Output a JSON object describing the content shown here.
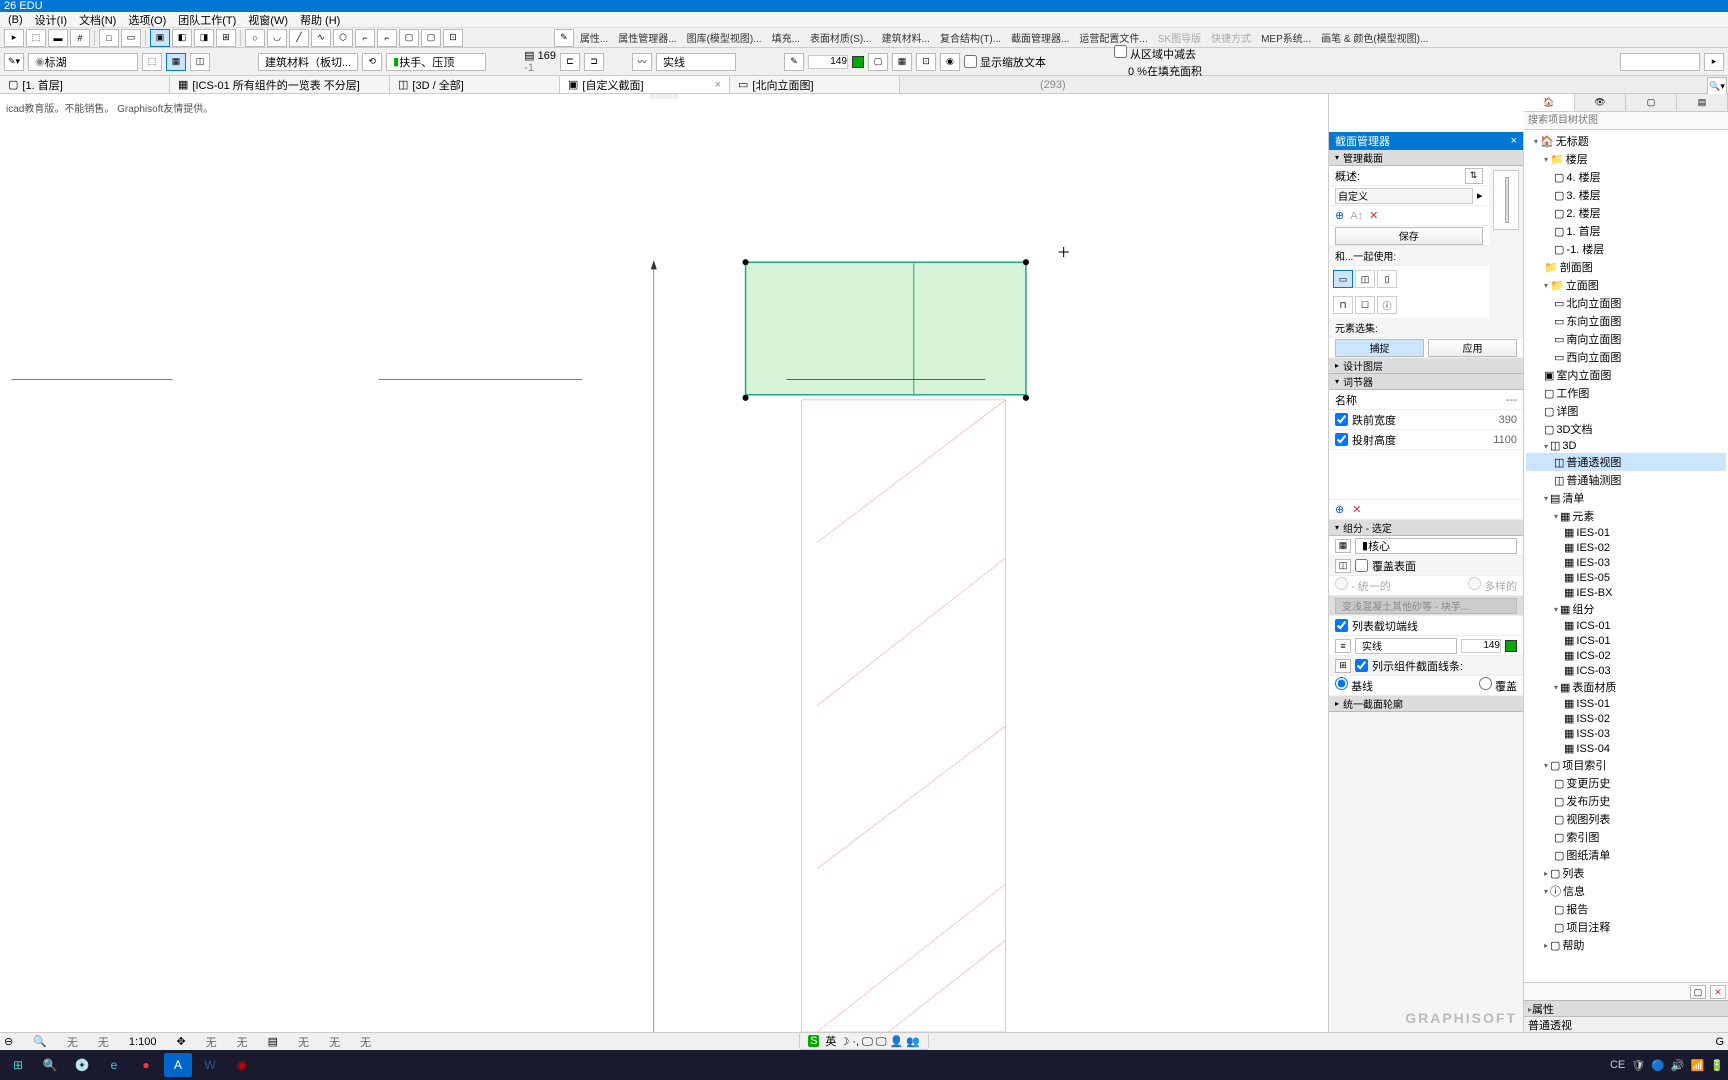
{
  "title": "26 EDU",
  "menus": [
    "(B)",
    "设计(I)",
    "文档(N)",
    "选项(O)",
    "团队工作(T)",
    "视窗(W)",
    "帮助 (H)"
  ],
  "toolbar1": {
    "labels": [
      "属性...",
      "属性管理器...",
      "图库(模型视图)...",
      "填充...",
      "表面材质(S)...",
      "建筑材料...",
      "复合结构(T)...",
      "截面管理器...",
      "运营配置文件...",
      "SK图导版",
      "快捷方式",
      "MEP系统...",
      "画笔 & 颜色(模型视图)..."
    ]
  },
  "toolbar2": {
    "dropdown1": "标湖",
    "dropdown2": "建筑材料（板切...",
    "dropdown3": "扶手、压顶",
    "lineStyle": "实线",
    "num1": "169",
    "pen1": "149",
    "opt1_label": "从区域中减去",
    "opt1_val": "0",
    "opt2_label": "%在填充面积",
    "check_label": "显示缩放文本"
  },
  "tabs": [
    {
      "label": "[1. 首层]",
      "icon": "floor"
    },
    {
      "label": "[ICS-01 所有组件的一览表 不分层]",
      "icon": "grid"
    },
    {
      "label": "[3D / 全部]",
      "icon": "cube"
    },
    {
      "label": "[自定义截面]",
      "icon": "section",
      "closable": true
    },
    {
      "label": "[北向立面图]",
      "icon": "elev"
    }
  ],
  "coords": "(293)",
  "edu_text": "icad教育版。不能销售。  Graphisoft友情提供。",
  "section_panel": {
    "title": "截面管理器",
    "sub_manage": "管理截面",
    "desc_label": "概述:",
    "desc_value": "自定义",
    "save_btn": "保存",
    "use_with": "和...一起使用:",
    "element_sel": "元素选集:",
    "capture_btn": "捕捉",
    "apply_btn": "应用",
    "design_opts": "设计图层",
    "modifiers": "词节器",
    "name_label": "名称",
    "name_val": "---",
    "chk1_label": "跌前宽度",
    "chk1_val": "390",
    "chk2_label": "投射高度",
    "chk2_val": "1100",
    "components": "组分 - 选定",
    "core_label": "核心",
    "override_surface": "覆盖表面",
    "uniform": "- 统一的",
    "multiple": "多样的",
    "material": "变浅混凝土其他砂等 - 块芋...",
    "show_cut_end": "列表截切端线",
    "line_solid": "实线",
    "pen2": "149",
    "show_comp_end": "列示组件截面线条:",
    "radio_base": "基线",
    "radio_cover": "覆盖",
    "unified_edges": "统一截面轮廓"
  },
  "navigator": {
    "search_ph": "搜索项目树状图",
    "root": "无标题",
    "floors": {
      "label": "楼层",
      "items": [
        "4. 楼层",
        "3. 楼层",
        "2. 楼层",
        "1. 首层",
        "-1. 楼层"
      ]
    },
    "section_views": "剖面图",
    "elevations": {
      "label": "立面图",
      "items": [
        "北向立面图",
        "东向立面图",
        "南向立面图",
        "西向立面图"
      ]
    },
    "interior": "室内立面图",
    "worksheets": "工作图",
    "details": "详图",
    "docs3d": "3D文档",
    "views3d": {
      "label": "3D",
      "items": [
        "普通透视图",
        "普通轴测图"
      ]
    },
    "lists": {
      "label": "清单",
      "elements": {
        "label": "元素",
        "items": [
          "IES-01",
          "IES-02",
          "IES-03",
          "IES-05",
          "IES-BX"
        ]
      },
      "components": {
        "label": "组分",
        "items": [
          "ICS-01",
          "ICS-01",
          "ICS-02",
          "ICS-03"
        ]
      },
      "surfaces": {
        "label": "表面材质",
        "items": [
          "ISS-01",
          "ISS-02",
          "ISS-03",
          "ISS-04"
        ]
      }
    },
    "proj_index": {
      "label": "项目索引",
      "items": [
        "变更历史",
        "发布历史",
        "视图列表",
        "索引图",
        "图纸清单"
      ]
    },
    "index_list": "列表",
    "info": {
      "label": "信息",
      "items": [
        "报告",
        "项目注释"
      ]
    },
    "help": "帮助",
    "properties": "属性",
    "perspective": "普通透视"
  },
  "statusbar": {
    "scale": "1:100",
    "items": [
      "无",
      "无",
      "无",
      "无",
      "无",
      "无",
      "无"
    ]
  },
  "logo": "GRAPHISOFT",
  "center_tray": "英 ☽ ·, 🖵 🖵 👤 👥",
  "taskbar_time": "CE",
  "lang": "EN"
}
